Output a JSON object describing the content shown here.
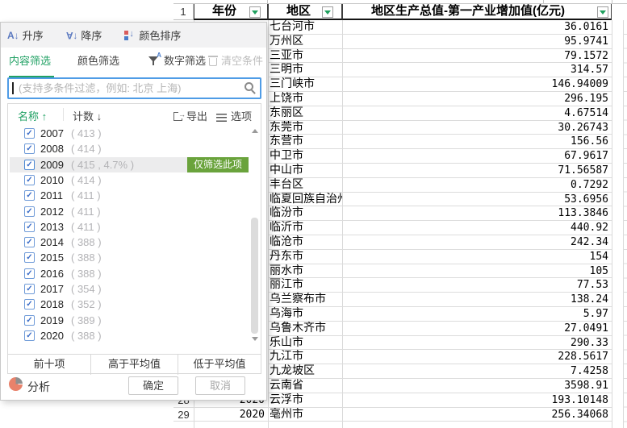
{
  "colors": {
    "accent_green": "#21a164",
    "only_button_green": "#6aa33c",
    "checkbox_blue": "#3a6cc7",
    "search_border_blue": "#4f9ce6",
    "analyze_pie_orange": "#e8826b"
  },
  "filter_panel": {
    "toolbar": {
      "sort_asc": "升序",
      "sort_desc": "降序",
      "sort_color": "颜色排序"
    },
    "tabs": {
      "content": "内容筛选",
      "color": "颜色筛选",
      "number": "数字筛选",
      "clear": "清空条件"
    },
    "search_placeholder": "(支持多条件过滤，例如: 北京 上海)",
    "list": {
      "col_name": "名称 ↑",
      "col_count": "计数 ↓",
      "export": "导出",
      "options": "选项",
      "only_this": "仅筛选此项",
      "items": [
        {
          "label": "2007",
          "count": "( 413 )",
          "checked": true
        },
        {
          "label": "2008",
          "count": "( 414 )",
          "checked": true
        },
        {
          "label": "2009",
          "count": "( 415 , 4.7% )",
          "checked": true,
          "highlighted": true
        },
        {
          "label": "2010",
          "count": "( 414 )",
          "checked": true
        },
        {
          "label": "2011",
          "count": "( 411 )",
          "checked": true
        },
        {
          "label": "2012",
          "count": "( 411 )",
          "checked": true
        },
        {
          "label": "2013",
          "count": "( 411 )",
          "checked": true
        },
        {
          "label": "2014",
          "count": "( 388 )",
          "checked": true
        },
        {
          "label": "2015",
          "count": "( 388 )",
          "checked": true
        },
        {
          "label": "2016",
          "count": "( 388 )",
          "checked": true
        },
        {
          "label": "2017",
          "count": "( 354 )",
          "checked": true
        },
        {
          "label": "2018",
          "count": "( 352 )",
          "checked": true
        },
        {
          "label": "2019",
          "count": "( 389 )",
          "checked": true
        },
        {
          "label": "2020",
          "count": "( 388 )",
          "checked": true
        }
      ]
    },
    "quick_filters": [
      "前十项",
      "高于平均值",
      "低于平均值"
    ],
    "footer": {
      "analyze": "分析",
      "ok": "确定",
      "cancel": "取消"
    }
  },
  "spreadsheet": {
    "first_row_number": "1",
    "col_year": "年份",
    "col_region": "地区",
    "col_value": "地区生产总值-第一产业增加值(亿元)",
    "rows": [
      {
        "city": "七台河市",
        "value": "36.0161"
      },
      {
        "city": "万州区",
        "value": "95.9741"
      },
      {
        "city": "三亚市",
        "value": "79.1572"
      },
      {
        "city": "三明市",
        "value": "314.57"
      },
      {
        "city": "三门峡市",
        "value": "146.94009"
      },
      {
        "city": "上饶市",
        "value": "296.195"
      },
      {
        "city": "东丽区",
        "value": "4.67514"
      },
      {
        "city": "东莞市",
        "value": "30.26743"
      },
      {
        "city": "东营市",
        "value": "156.56"
      },
      {
        "city": "中卫市",
        "value": "67.9617"
      },
      {
        "city": "中山市",
        "value": "71.56587"
      },
      {
        "city": "丰台区",
        "value": "0.7292"
      },
      {
        "city": "临夏回族自治州",
        "value": "53.6956"
      },
      {
        "city": "临汾市",
        "value": "113.3846"
      },
      {
        "city": "临沂市",
        "value": "440.92"
      },
      {
        "city": "临沧市",
        "value": "242.34"
      },
      {
        "city": "丹东市",
        "value": "154"
      },
      {
        "city": "丽水市",
        "value": "105"
      },
      {
        "city": "丽江市",
        "value": "77.53"
      },
      {
        "city": "乌兰察布市",
        "value": "138.24"
      },
      {
        "city": "乌海市",
        "value": "5.97"
      },
      {
        "city": "乌鲁木齐市",
        "value": "27.0491"
      },
      {
        "city": "乐山市",
        "value": "290.33"
      },
      {
        "city": "九江市",
        "value": "228.5617"
      },
      {
        "city": "九龙坡区",
        "value": "7.4258"
      },
      {
        "city": "云南省",
        "value": "3598.91"
      },
      {
        "row_number": "28",
        "year": "2020",
        "city": "云浮市",
        "value": "193.10148"
      },
      {
        "row_number": "29",
        "year": "2020",
        "city": "亳州市",
        "value": "256.34068"
      }
    ]
  }
}
